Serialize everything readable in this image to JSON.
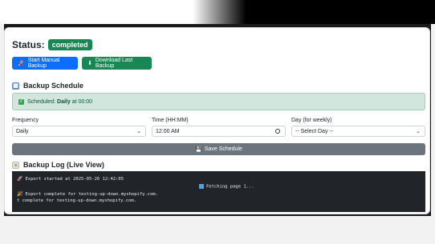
{
  "status": {
    "label": "Status:",
    "badge": "completed"
  },
  "actions": {
    "manual_backup": "Start Manual Backup",
    "download_backup": "Download Last Backup"
  },
  "schedule": {
    "title": "Backup Schedule",
    "alert_prefix": "Scheduled:",
    "alert_frequency": "Daily",
    "alert_suffix": "at 00:00",
    "frequency_label": "Frequency",
    "frequency_value": "Daily",
    "time_label": "Time (HH:MM)",
    "time_value": "12:00 AM",
    "day_label": "Day (for weekly)",
    "day_value": "-- Select Day --",
    "save_label": "Save Schedule"
  },
  "log": {
    "title": "Backup Log (Live View)",
    "lines": [
      "Export started at 2025-05-26 12:42:05",
      "Fetching page 1...",
      "Export complete for testing-up-down.myshopify.com.",
      "t complete for testing-up-down.myshopify.com."
    ]
  }
}
